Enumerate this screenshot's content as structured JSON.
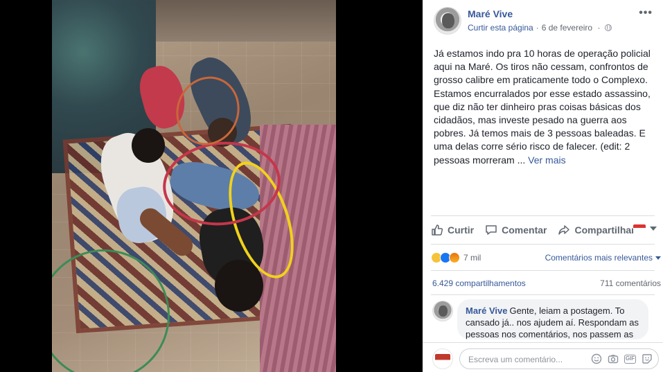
{
  "post": {
    "page_name": "Maré Vive",
    "like_page_label": "Curtir esta página",
    "separator": "·",
    "date": "6 de fevereiro",
    "more_label": "•••",
    "text": "Já estamos indo pra 10 horas de operação policial aqui na Maré. Os tiros não cessam, confrontos de grosso calibre em praticamente todo o Complexo. Estamos encurralados por esse estado assassino, que diz não ter dinheiro pras coisas básicas dos cidadãos, mas investe pesado na guerra aos pobres. Já temos mais de 3 pessoas baleadas. E uma delas corre sério risco de falecer. (edit: 2 pessoas morreram ...",
    "see_more": "Ver mais"
  },
  "actions": {
    "like": "Curtir",
    "comment": "Comentar",
    "share": "Compartilhar"
  },
  "stats": {
    "reactions_count": "7 mil",
    "sort_label": "Comentários mais relevantes",
    "shares": "6.429 compartilhamentos",
    "comments": "711 comentários"
  },
  "comment": {
    "author": "Maré Vive",
    "text": "Gente, leiam a postagem. To cansado já.. nos ajudem aí. Respondam as pessoas nos comentários, nos passem as"
  },
  "composer": {
    "placeholder": "Escreva um comentário...",
    "gif_label": "GIF"
  },
  "colors": {
    "link": "#365899",
    "text": "#1d2129",
    "muted": "#616770",
    "divider": "#dadde1"
  }
}
